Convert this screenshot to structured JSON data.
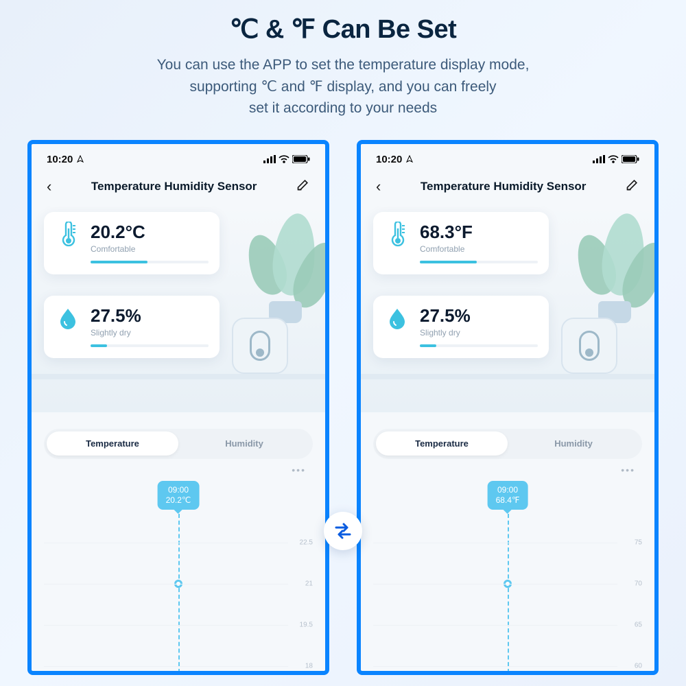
{
  "heading": {
    "title": "℃ & ℉ Can Be Set",
    "line1": "You can use the APP to set the temperature display mode,",
    "line2": "supporting ℃ and ℉ display, and you can freely",
    "line3": "set it according to your needs"
  },
  "statusbar": {
    "time": "10:20"
  },
  "page_title": "Temperature Humidity Sensor",
  "tabs": {
    "temperature": "Temperature",
    "humidity": "Humidity"
  },
  "left": {
    "temp": {
      "value": "20.2°C",
      "sub": "Comfortable"
    },
    "hum": {
      "value": "27.5%",
      "sub": "Slightly dry"
    },
    "tooltip": {
      "time": "09:00",
      "value": "20.2℃"
    },
    "yticks": [
      "22.5",
      "21",
      "19.5",
      "18"
    ]
  },
  "right": {
    "temp": {
      "value": "68.3°F",
      "sub": "Comfortable"
    },
    "hum": {
      "value": "27.5%",
      "sub": "Slightly dry"
    },
    "tooltip": {
      "time": "09:00",
      "value": "68.4℉"
    },
    "yticks": [
      "75",
      "70",
      "65",
      "60"
    ]
  },
  "chart_data": [
    {
      "type": "line",
      "title": "Temperature (°C)",
      "xlabel": "",
      "ylabel": "",
      "ylim": [
        18,
        22.5
      ],
      "x": [
        "09:00"
      ],
      "values": [
        20.2
      ],
      "yticks": [
        22.5,
        21,
        19.5,
        18
      ]
    },
    {
      "type": "line",
      "title": "Temperature (°F)",
      "xlabel": "",
      "ylabel": "",
      "ylim": [
        60,
        75
      ],
      "x": [
        "09:00"
      ],
      "values": [
        68.4
      ],
      "yticks": [
        75,
        70,
        65,
        60
      ]
    }
  ]
}
